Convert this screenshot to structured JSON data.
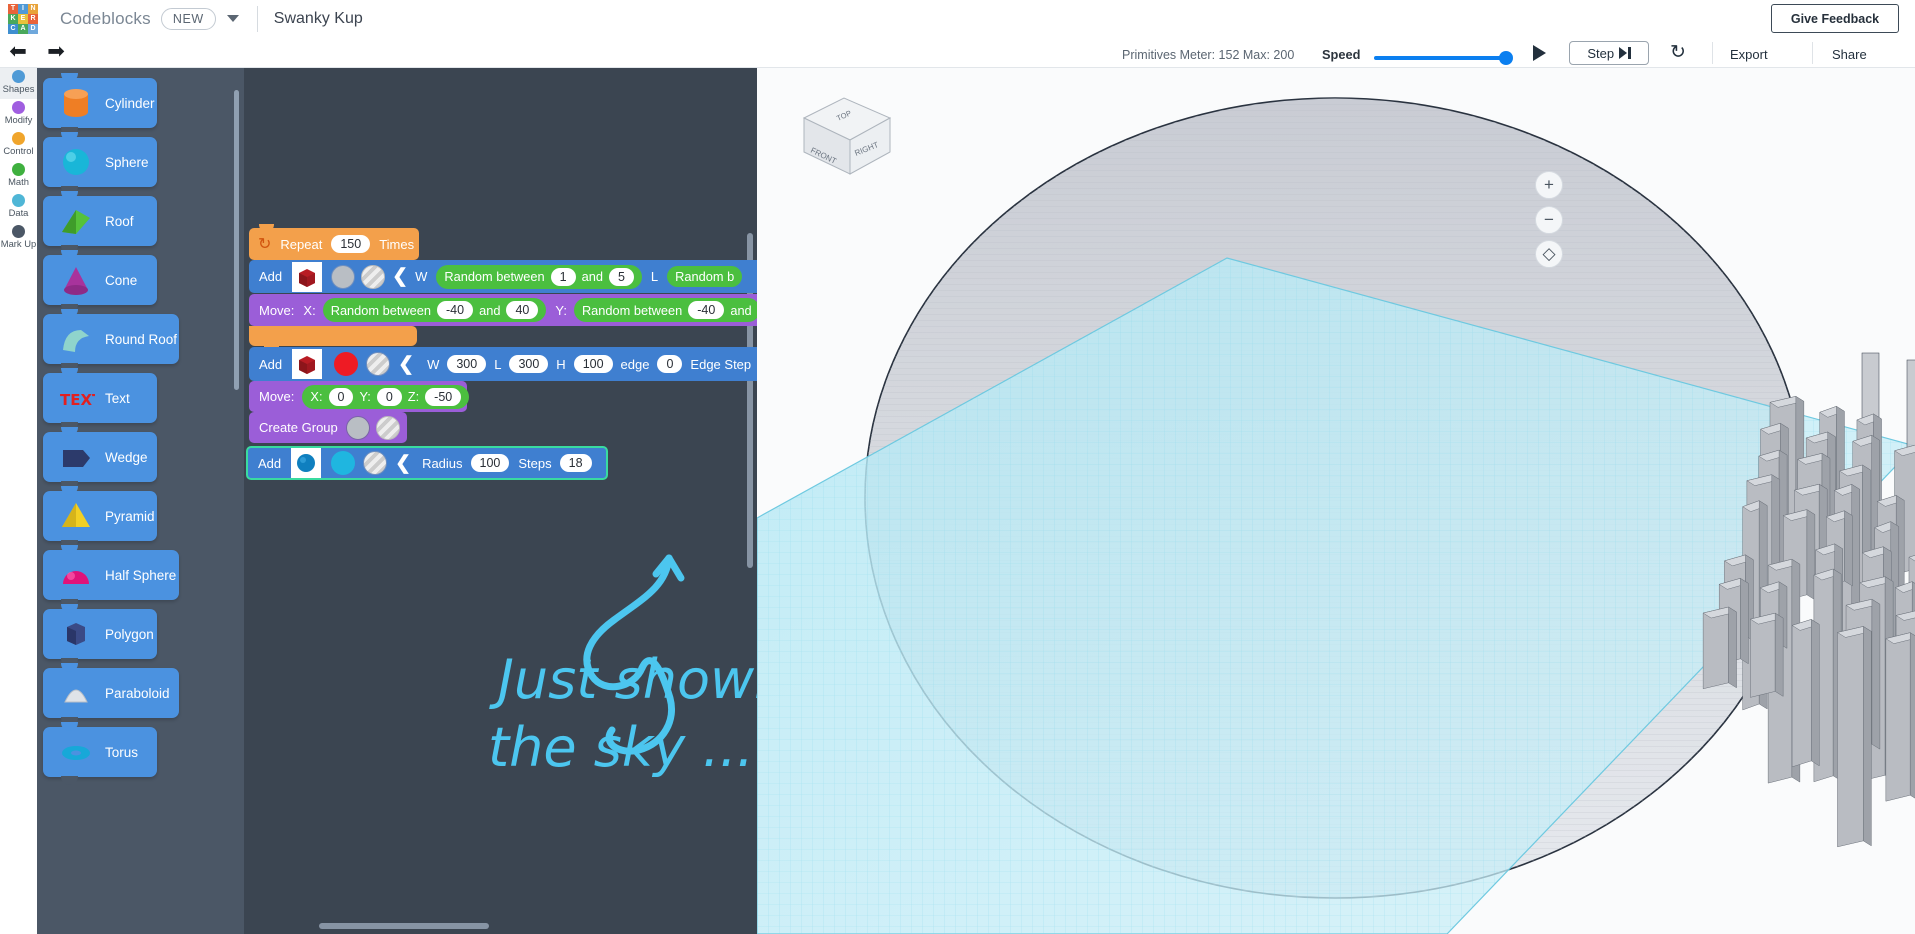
{
  "header": {
    "logo_tiles": [
      {
        "ch": "T",
        "color": "#e8633a"
      },
      {
        "ch": "I",
        "color": "#4f9ad6"
      },
      {
        "ch": "N",
        "color": "#e8a33a"
      },
      {
        "ch": "K",
        "color": "#4aa85c"
      },
      {
        "ch": "E",
        "color": "#e8c23a"
      },
      {
        "ch": "R",
        "color": "#e8633a"
      },
      {
        "ch": "C",
        "color": "#3f8fd0"
      },
      {
        "ch": "A",
        "color": "#4aa85c"
      },
      {
        "ch": "D",
        "color": "#6fa8dc"
      }
    ],
    "brand": "Codeblocks",
    "new_badge": "NEW",
    "doc_name": "Swanky Kup",
    "feedback_button": "Give Feedback",
    "caret_icon": "chevron-down-icon"
  },
  "toolbar": {
    "undo_icon": "undo-arrow-icon",
    "redo_icon": "redo-arrow-icon",
    "meter_text": "Primitives Meter: 152 Max: 200",
    "speed_label": "Speed",
    "play_icon": "play-icon",
    "step_label": "Step",
    "step_icon": "step-forward-icon",
    "restart_icon": "restart-icon",
    "export_label": "Export",
    "share_label": "Share",
    "accent": "#0b7ff0"
  },
  "rail": {
    "items": [
      {
        "label": "Shapes",
        "color": "#4f9ad6",
        "icon": "shapes-dot-icon",
        "active": true
      },
      {
        "label": "Modify",
        "color": "#a05ee0",
        "icon": "modify-dot-icon",
        "active": false
      },
      {
        "label": "Control",
        "color": "#f0a52c",
        "icon": "control-dot-icon",
        "active": false
      },
      {
        "label": "Math",
        "color": "#3fb03f",
        "icon": "math-dot-icon",
        "active": false
      },
      {
        "label": "Data",
        "color": "#4fb6d6",
        "icon": "data-dot-icon",
        "active": false
      },
      {
        "label": "Mark Up",
        "color": "#4b5766",
        "icon": "markup-dot-icon",
        "active": false
      }
    ]
  },
  "palette": {
    "shapes": [
      {
        "label": "Cylinder",
        "icon": "cylinder-shape-icon",
        "color": "#ef7e24"
      },
      {
        "label": "Sphere",
        "icon": "sphere-shape-icon",
        "color": "#19b6d8"
      },
      {
        "label": "Roof",
        "icon": "roof-shape-icon",
        "color": "#55c23a"
      },
      {
        "label": "Cone",
        "icon": "cone-shape-icon",
        "color": "#a8339c"
      },
      {
        "label": "Round Roof",
        "icon": "round-roof-shape-icon",
        "color": "#8fd4cc"
      },
      {
        "label": "Text",
        "icon": "text-shape-icon",
        "color": "#e22020"
      },
      {
        "label": "Wedge",
        "icon": "wedge-shape-icon",
        "color": "#2c3a6b"
      },
      {
        "label": "Pyramid",
        "icon": "pyramid-shape-icon",
        "color": "#f2d024"
      },
      {
        "label": "Half Sphere",
        "icon": "half-sphere-shape-icon",
        "color": "#e0137a"
      },
      {
        "label": "Polygon",
        "icon": "polygon-shape-icon",
        "color": "#3a4a86"
      },
      {
        "label": "Paraboloid",
        "icon": "paraboloid-shape-icon",
        "color": "#dfe3e8"
      },
      {
        "label": "Torus",
        "icon": "torus-shape-icon",
        "color": "#17a8d8"
      }
    ]
  },
  "code": {
    "repeat": {
      "verb": "Repeat",
      "count": "150",
      "unit": "Times",
      "icon": "repeat-loop-icon"
    },
    "add_random": {
      "verb": "Add",
      "shape_icon": "box-shape-icon",
      "color_icon": "grey-solid-icon",
      "hole_icon": "hole-hatch-icon",
      "chevron": "chevron-left-icon",
      "w_label": "W",
      "w_rand": "Random between",
      "w_min": "1",
      "w_and": "and",
      "w_max": "5",
      "l_label": "L",
      "l_rand": "Random b"
    },
    "move_random": {
      "verb": "Move:",
      "x_label": "X:",
      "x_rand": "Random between",
      "x_min": "-40",
      "x_and": "and",
      "x_max": "40",
      "y_label": "Y:",
      "y_rand": "Random between",
      "y_min": "-40",
      "y_and": "and"
    },
    "add_ground": {
      "verb": "Add",
      "shape_icon": "box-shape-icon",
      "color_icon": "red-solid-icon",
      "hole_icon": "hole-hatch-icon",
      "chevron": "chevron-left-icon",
      "w_label": "W",
      "w_val": "300",
      "l_label": "L",
      "l_val": "300",
      "h_label": "H",
      "h_val": "100",
      "edge_label": "edge",
      "edge_val": "0",
      "steps_label": "Edge Step"
    },
    "move_ground": {
      "verb": "Move:",
      "x_label": "X:",
      "x_val": "0",
      "y_label": "Y:",
      "y_val": "0",
      "z_label": "Z:",
      "z_val": "-50"
    },
    "create_group": {
      "label": "Create Group",
      "color_icon": "grey-solid-icon",
      "hole_icon": "hole-hatch-icon"
    },
    "add_sphere": {
      "verb": "Add",
      "shape_icon": "sphere-shape-icon",
      "color_icon": "cyan-solid-icon",
      "hole_icon": "hole-hatch-icon",
      "chevron": "chevron-left-icon",
      "radius_label": "Radius",
      "radius_val": "100",
      "steps_label": "Steps",
      "steps_val": "18"
    },
    "annotation": "Just showing the sky ...",
    "annotation_color": "#4cc6ef",
    "trash_icon": "trash-can-icon",
    "zoom_in_icon": "zoom-in-icon",
    "zoom_out_icon": "zoom-out-icon",
    "zoom_fit_icon": "zoom-fit-icon"
  },
  "viewport": {
    "view_cube": {
      "top": "TOP",
      "front": "FRONT",
      "right": "RIGHT"
    },
    "zoom_in_icon": "plus-icon",
    "zoom_out_icon": "minus-icon",
    "fit_view_icon": "fit-view-icon"
  }
}
